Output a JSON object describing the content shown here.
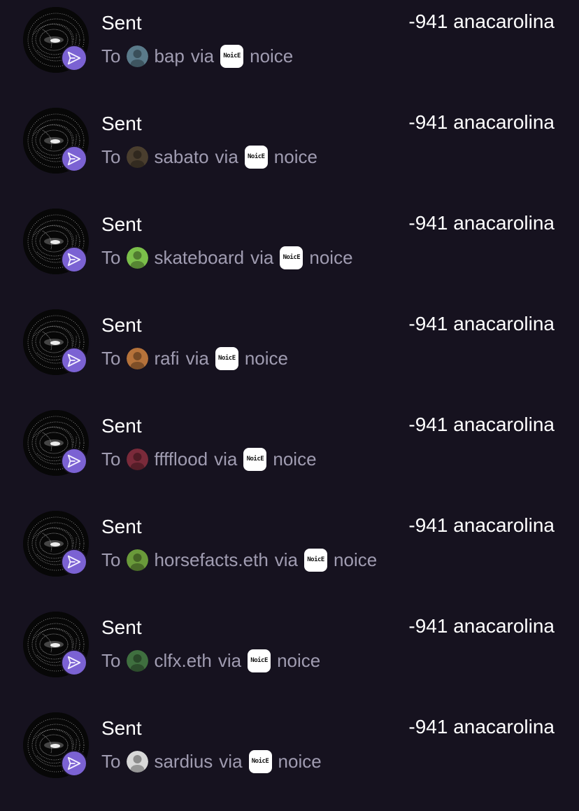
{
  "transactions": [
    {
      "title": "Sent",
      "amount": "-941 anacarolina",
      "to_label": "To",
      "recipient": "bap",
      "via_label": "via",
      "app_icon_text": "NoicE",
      "app": "noice",
      "recipient_avatar_color": "#5a7a8a"
    },
    {
      "title": "Sent",
      "amount": "-941 anacarolina",
      "to_label": "To",
      "recipient": "sabato",
      "via_label": "via",
      "app_icon_text": "NoicE",
      "app": "noice",
      "recipient_avatar_color": "#4a3e2e"
    },
    {
      "title": "Sent",
      "amount": "-941 anacarolina",
      "to_label": "To",
      "recipient": "skateboard",
      "via_label": "via",
      "app_icon_text": "NoicE",
      "app": "noice",
      "recipient_avatar_color": "#7bbf4a"
    },
    {
      "title": "Sent",
      "amount": "-941 anacarolina",
      "to_label": "To",
      "recipient": "rafi",
      "via_label": "via",
      "app_icon_text": "NoicE",
      "app": "noice",
      "recipient_avatar_color": "#b5723a"
    },
    {
      "title": "Sent",
      "amount": "-941 anacarolina",
      "to_label": "To",
      "recipient": "fffflood",
      "via_label": "via",
      "app_icon_text": "NoicE",
      "app": "noice",
      "recipient_avatar_color": "#7a2a3a"
    },
    {
      "title": "Sent",
      "amount": "-941 anacarolina",
      "to_label": "To",
      "recipient": "horsefacts.eth",
      "via_label": "via",
      "app_icon_text": "NoicE",
      "app": "noice",
      "recipient_avatar_color": "#6a9a3a"
    },
    {
      "title": "Sent",
      "amount": "-941 anacarolina",
      "to_label": "To",
      "recipient": "clfx.eth",
      "via_label": "via",
      "app_icon_text": "NoicE",
      "app": "noice",
      "recipient_avatar_color": "#3f6f3f"
    },
    {
      "title": "Sent",
      "amount": "-941 anacarolina",
      "to_label": "To",
      "recipient": "sardius",
      "via_label": "via",
      "app_icon_text": "NoicE",
      "app": "noice",
      "recipient_avatar_color": "#d8d8d8"
    }
  ],
  "colors": {
    "background": "#16121f",
    "badge": "#7b62d3",
    "secondary_text": "#a09cb1"
  },
  "icons": {
    "send": "paper-plane-icon",
    "avatar": "spiral-art-avatar"
  }
}
